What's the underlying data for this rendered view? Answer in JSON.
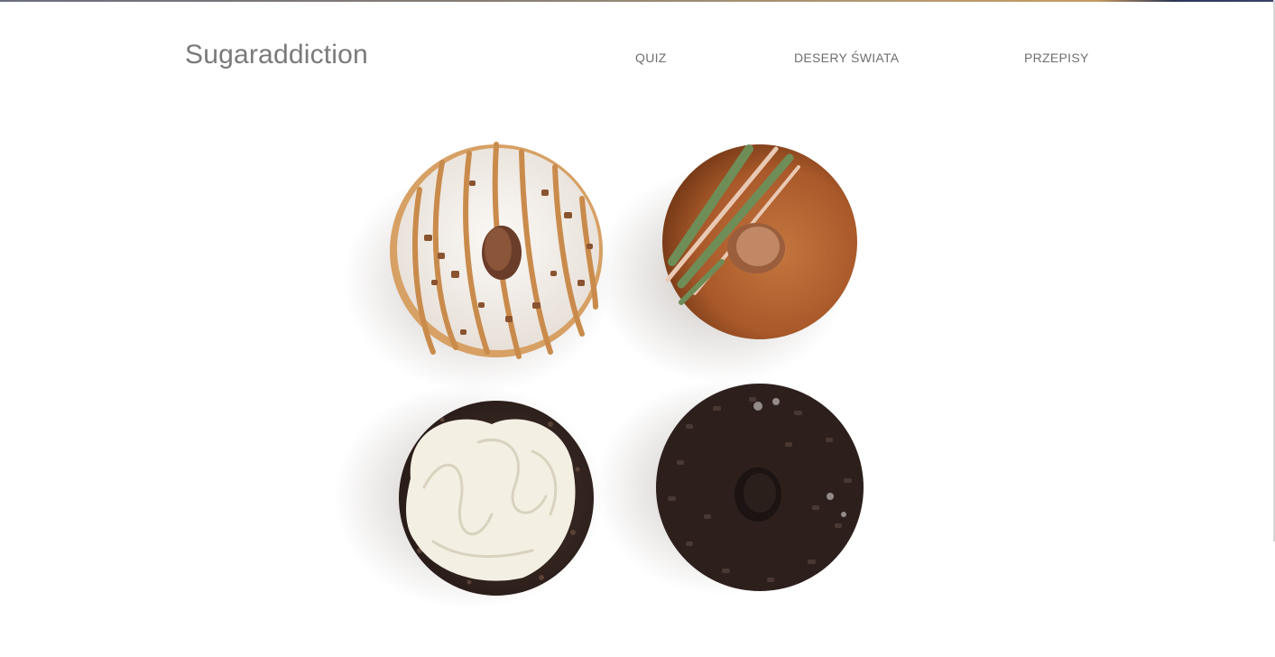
{
  "header": {
    "logo": "Sugaraddiction",
    "nav": [
      {
        "label": "QUIZ"
      },
      {
        "label": "DESERY ŚWIATA"
      },
      {
        "label": "PRZEPISY"
      }
    ]
  },
  "hero": {
    "image": "four donuts photo",
    "colors": {
      "white_glaze": "#f4f1ee",
      "caramel": "#c98b4c",
      "brown_glaze": "#a85a2a",
      "chocolate": "#3a2a24",
      "cream": "#f3efe2"
    }
  }
}
